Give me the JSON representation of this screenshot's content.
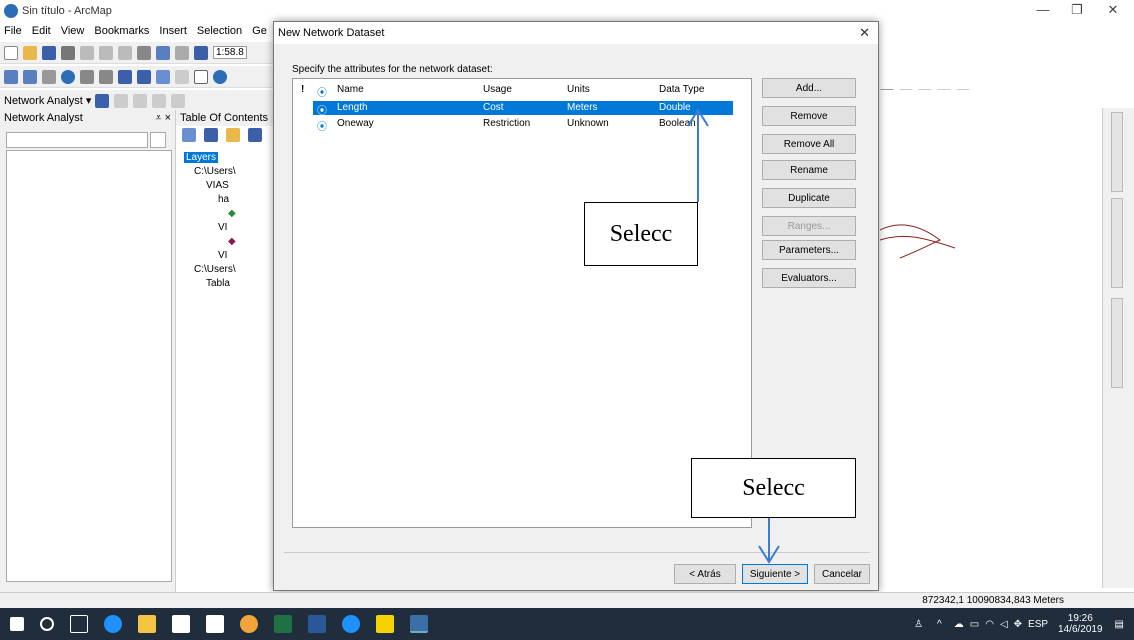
{
  "window": {
    "title": "Sin título - ArcMap"
  },
  "menu": [
    "File",
    "Edit",
    "View",
    "Bookmarks",
    "Insert",
    "Selection",
    "Ge"
  ],
  "toolbar": {
    "scale_value": "1:58.8",
    "network_analyst_label": "Network Analyst ▾"
  },
  "na_panel": {
    "title": "Network Analyst",
    "pin": "⩡ ×"
  },
  "toc": {
    "title": "Table Of Contents",
    "items": [
      "Layers",
      "C:\\Users\\",
      "VIAS",
      "ha",
      "VI",
      "VI",
      "C:\\Users\\",
      "Tabla"
    ]
  },
  "dialog": {
    "title": "New Network Dataset",
    "instruction": "Specify the attributes for the network dataset:",
    "columns": {
      "flag": "!",
      "icon": "⦿",
      "name": "Name",
      "usage": "Usage",
      "units": "Units",
      "data_type": "Data Type"
    },
    "rows": [
      {
        "name": "Length",
        "usage": "Cost",
        "units": "Meters",
        "data_type": "Double"
      },
      {
        "name": "Oneway",
        "usage": "Restriction",
        "units": "Unknown",
        "data_type": "Boolean"
      }
    ],
    "buttons": {
      "add": "Add...",
      "remove": "Remove",
      "remove_all": "Remove All",
      "rename": "Rename",
      "duplicate": "Duplicate",
      "ranges": "Ranges...",
      "parameters": "Parameters...",
      "evaluators": "Evaluators..."
    },
    "nav": {
      "back": "< Atrás",
      "next": "Siguiente >",
      "cancel": "Cancelar"
    }
  },
  "callouts": {
    "top": "Selecc",
    "bottom": "Selecc"
  },
  "status": {
    "coords": "872342,1  10090834,843 Meters"
  },
  "tray": {
    "lang": "ESP",
    "time": "19:26",
    "date": "14/6/2019"
  },
  "colors": {
    "selection": "#0078d7",
    "taskbar": "#1f2d3d",
    "arrow": "#3a7bd5"
  }
}
